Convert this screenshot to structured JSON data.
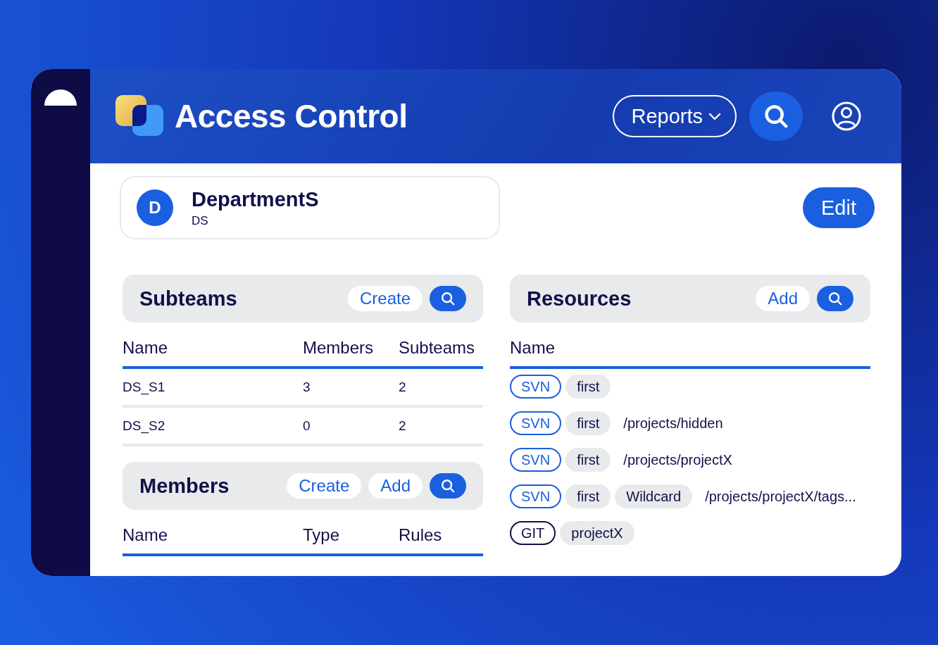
{
  "header": {
    "title": "Access Control",
    "reports_menu": "Reports"
  },
  "department": {
    "initial": "D",
    "name": "DepartmentS",
    "code": "DS",
    "edit_button": "Edit"
  },
  "subteams": {
    "title": "Subteams",
    "actions": [
      "Create"
    ],
    "columns": [
      "Name",
      "Members",
      "Subteams"
    ],
    "rows": [
      [
        "DS_S1",
        "3",
        "2"
      ],
      [
        "DS_S2",
        "0",
        "2"
      ]
    ]
  },
  "members": {
    "title": "Members",
    "actions": [
      "Create",
      "Add"
    ],
    "columns": [
      "Name",
      "Type",
      "Rules"
    ]
  },
  "resources": {
    "title": "Resources",
    "actions": [
      "Add"
    ],
    "columns": [
      "Name"
    ],
    "rows": [
      {
        "type": "SVN",
        "color": "#1a5fe0",
        "labels": [
          "first"
        ]
      },
      {
        "type": "SVN",
        "color": "#1a5fe0",
        "labels": [
          "first"
        ],
        "path": "/projects/hidden"
      },
      {
        "type": "SVN",
        "color": "#1a5fe0",
        "labels": [
          "first"
        ],
        "path": "/projects/projectX"
      },
      {
        "type": "SVN",
        "color": "#1a5fe0",
        "labels": [
          "first",
          "Wildcard"
        ],
        "path": "/projects/projectX/tags..."
      },
      {
        "type": "GIT",
        "color": "#12104a",
        "labels": [
          "projectX"
        ]
      }
    ]
  }
}
